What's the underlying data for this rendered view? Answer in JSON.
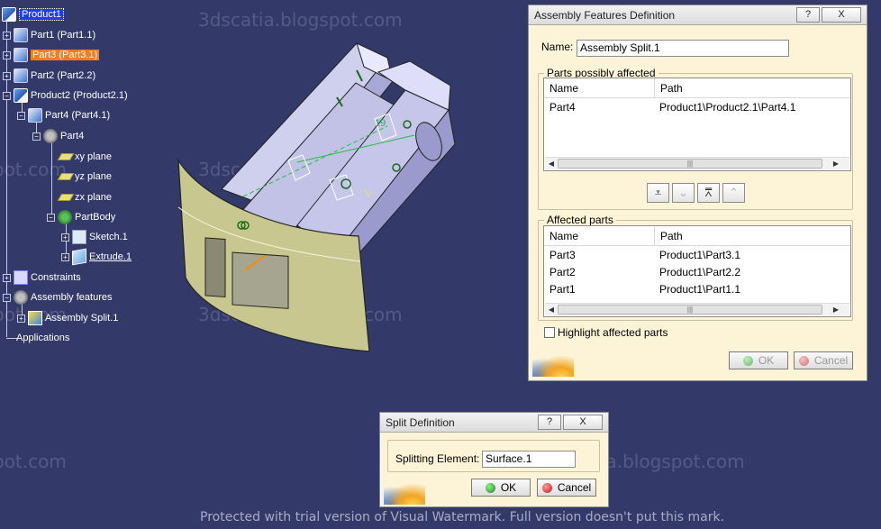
{
  "watermark_text": "3dscatia.blogspot.com",
  "footer_watermark": "Protected with trial version of Visual Watermark. Full version doesn't put this mark.",
  "tree": {
    "product1": "Product1",
    "part1": "Part1 (Part1.1)",
    "part3": "Part3 (Part3.1)",
    "part2": "Part2 (Part2.2)",
    "product2": "Product2 (Product2.1)",
    "part4_inst": "Part4 (Part4.1)",
    "part4": "Part4",
    "xy_plane": "xy plane",
    "yz_plane": "yz plane",
    "zx_plane": "zx plane",
    "partbody": "PartBody",
    "sketch": "Sketch.1",
    "extrude": "Extrude.1",
    "constraints": "Constraints",
    "assembly_features": "Assembly features",
    "assembly_split": "Assembly Split.1",
    "applications": "Applications"
  },
  "viewport": {
    "dimension_label": "19",
    "axis_label": "V"
  },
  "assembly_dialog": {
    "title": "Assembly Features Definition",
    "help_btn": "?",
    "close_btn": "X",
    "name_label": "Name:",
    "name_value": "Assembly Split.1",
    "possibly_affected_title": "Parts possibly affected",
    "col_name": "Name",
    "col_path": "Path",
    "possibly_affected_rows": [
      {
        "name": "Part4",
        "path": "Product1\\Product2.1\\Part4.1"
      }
    ],
    "affected_title": "Affected parts",
    "affected_rows": [
      {
        "name": "Part3",
        "path": "Product1\\Part3.1"
      },
      {
        "name": "Part2",
        "path": "Product1\\Part2.2"
      },
      {
        "name": "Part1",
        "path": "Product1\\Part1.1"
      }
    ],
    "highlight_label": "Highlight affected parts",
    "highlight_checked": false,
    "ok_label": "OK",
    "cancel_label": "Cancel"
  },
  "split_dialog": {
    "title": "Split Definition",
    "help_btn": "?",
    "close_btn": "X",
    "element_label": "Splitting Element:",
    "element_value": "Surface.1",
    "ok_label": "OK",
    "cancel_label": "Cancel"
  },
  "colors": {
    "background": "#333a6a",
    "dialog_bg": "#fdf3d6",
    "highlight_orange": "#ff7a1a",
    "selection_blue": "#1e3cff",
    "surface_olive": "#c7c78f",
    "part_lavender": "#bdbde2"
  }
}
